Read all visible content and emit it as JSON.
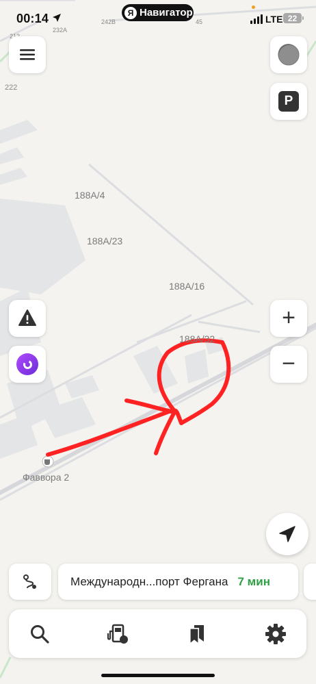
{
  "status_bar": {
    "time": "00:14",
    "app_pill": "Навигатор",
    "app_pill_logo": "Я",
    "network": "LTE",
    "battery": "22"
  },
  "map": {
    "labels": {
      "building_1": "188А/4",
      "building_2": "188А/23",
      "building_3": "188А/16",
      "building_4": "188А/32",
      "poi": "Фаввора 2",
      "road_1": "232А",
      "road_2": "242В",
      "road_3": "45",
      "road_4": "222",
      "road_5": "212"
    },
    "annotation_color": "#ff2222"
  },
  "controls": {
    "parking_label": "P",
    "zoom_in": "+",
    "zoom_out": "−"
  },
  "route_bar": {
    "destination": "Международн...порт Фергана",
    "eta": "7 мин",
    "eta_color": "#2ea043"
  },
  "tabbar": {
    "icons": [
      "search-icon",
      "fuel-icon",
      "bookmarks-icon",
      "settings-icon"
    ]
  },
  "colors": {
    "map_bg": "#f4f3ef",
    "alice_purple": "#8a2be2"
  }
}
